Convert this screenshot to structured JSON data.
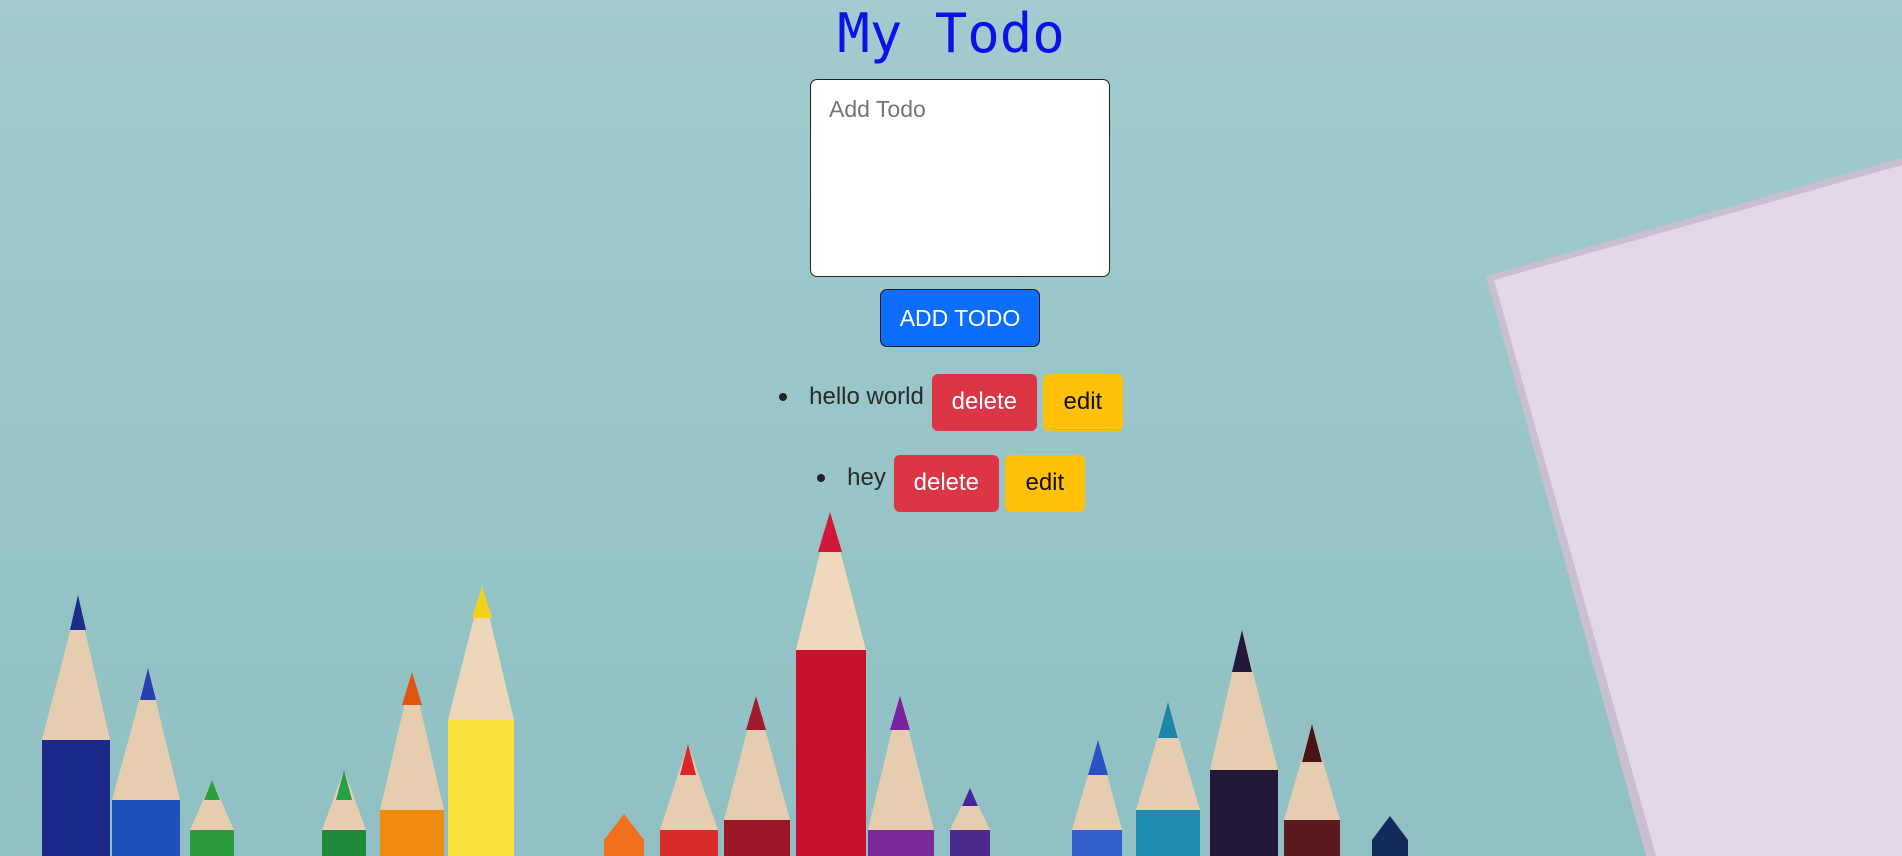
{
  "app": {
    "title": "My Todo"
  },
  "input": {
    "value": "",
    "placeholder": "Add Todo"
  },
  "add_button": {
    "label": "ADD TODO"
  },
  "todos": [
    {
      "text": "hello world",
      "delete_label": "delete",
      "edit_label": "edit"
    },
    {
      "text": "hey",
      "delete_label": "delete",
      "edit_label": "edit"
    }
  ],
  "colors": {
    "background": "#9cc7cb",
    "title": "#0a12e6",
    "primary": "#0d6efd",
    "danger": "#dc3545",
    "warning": "#ffc107",
    "paper": "#e2d6e8"
  }
}
